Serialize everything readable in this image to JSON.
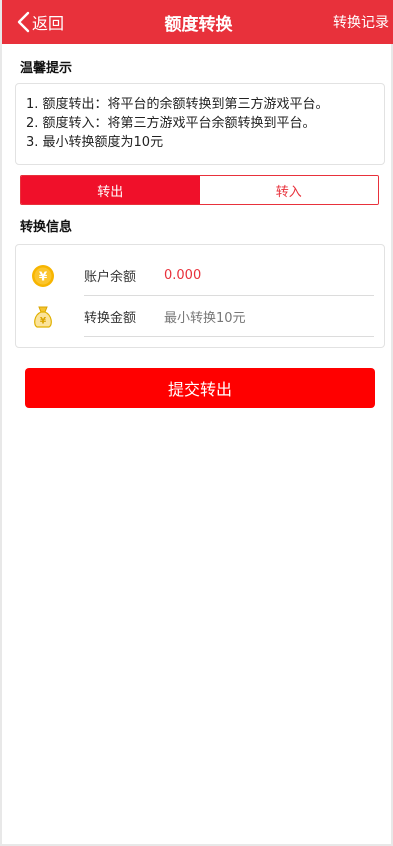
{
  "header": {
    "back_label": "返回",
    "title": "额度转换",
    "records_label": "转换记录",
    "bg_color": "#e8313b"
  },
  "tips": {
    "title": "温馨提示",
    "items": [
      "1. 额度转出：将平台的余额转换到第三方游戏平台。",
      "2. 额度转入：将第三方游戏平台余额转换到平台。",
      "3. 最小转换额度为10元"
    ]
  },
  "tabs": [
    {
      "label": "转出",
      "active": true
    },
    {
      "label": "转入",
      "active": false
    }
  ],
  "info": {
    "title": "转换信息",
    "balance_label": "账户余额",
    "balance_value": "0.000",
    "amount_label": "转换金额",
    "amount_placeholder": "最小转换10元",
    "balance_icon": "yen-coin-icon",
    "amount_icon": "money-bag-icon"
  },
  "submit_label": "提交转出",
  "accent_color": "#ff0000"
}
